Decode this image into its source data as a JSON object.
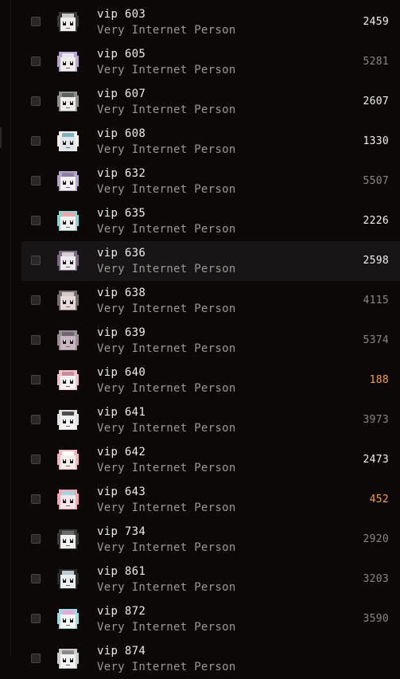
{
  "list": {
    "rows": [
      {
        "name": "vip 603",
        "subtitle": "Very Internet Person",
        "value": "2459",
        "value_style": "bright",
        "avatar": {
          "hair": "#3a3a3a",
          "face": "#f1ecec",
          "accent": "#c8c8c8"
        }
      },
      {
        "name": "vip 605",
        "subtitle": "Very Internet Person",
        "value": "5281",
        "value_style": "dim",
        "avatar": {
          "hair": "#b9a6cf",
          "face": "#f1ecec",
          "accent": "#e9e4f2"
        }
      },
      {
        "name": "vip 607",
        "subtitle": "Very Internet Person",
        "value": "2607",
        "value_style": "bright",
        "avatar": {
          "hair": "#8f918f",
          "face": "#f1ecec",
          "accent": "#5d625f"
        }
      },
      {
        "name": "vip 608",
        "subtitle": "Very Internet Person",
        "value": "1330",
        "value_style": "bright",
        "avatar": {
          "hair": "#f4eee6",
          "face": "#dfe7ea",
          "accent": "#7fb1bd"
        }
      },
      {
        "name": "vip 632",
        "subtitle": "Very Internet Person",
        "value": "5507",
        "value_style": "dim",
        "avatar": {
          "hair": "#b7a6c8",
          "face": "#f3eef3",
          "accent": "#8c7fa2"
        }
      },
      {
        "name": "vip 635",
        "subtitle": "Very Internet Person",
        "value": "2226",
        "value_style": "bright",
        "avatar": {
          "hair": "#8ed3cf",
          "face": "#f3f1f0",
          "accent": "#f0a6a6"
        }
      },
      {
        "name": "vip 636",
        "subtitle": "Very Internet Person",
        "value": "2598",
        "value_style": "bright",
        "avatar": {
          "hair": "#7b6c84",
          "face": "#efe8ee",
          "accent": "#d6d0d8"
        }
      },
      {
        "name": "vip 638",
        "subtitle": "Very Internet Person",
        "value": "4115",
        "value_style": "dim",
        "avatar": {
          "hair": "#7a6f6f",
          "face": "#e7d9d9",
          "accent": "#d2c9c9"
        }
      },
      {
        "name": "vip 639",
        "subtitle": "Very Internet Person",
        "value": "5374",
        "value_style": "dim",
        "avatar": {
          "hair": "#9b8e94",
          "face": "#c9b7c4",
          "accent": "#6f6570"
        }
      },
      {
        "name": "vip 640",
        "subtitle": "Very Internet Person",
        "value": "188",
        "value_style": "orange",
        "avatar": {
          "hair": "#f1c4cb",
          "face": "#f6f2f4",
          "accent": "#c98aa0"
        }
      },
      {
        "name": "vip 641",
        "subtitle": "Very Internet Person",
        "value": "3973",
        "value_style": "dim",
        "avatar": {
          "hair": "#e3e3e3",
          "face": "#f4f4f4",
          "accent": "#4e4e4e"
        }
      },
      {
        "name": "vip 642",
        "subtitle": "Very Internet Person",
        "value": "2473",
        "value_style": "bright",
        "avatar": {
          "hair": "#f2b6bf",
          "face": "#f3ece8",
          "accent": "#ffffff"
        }
      },
      {
        "name": "vip 643",
        "subtitle": "Very Internet Person",
        "value": "452",
        "value_style": "orange",
        "avatar": {
          "hair": "#f1aab3",
          "face": "#f3e6ea",
          "accent": "#a9d2dc"
        }
      },
      {
        "name": "vip 734",
        "subtitle": "Very Internet Person",
        "value": "2920",
        "value_style": "dim",
        "avatar": {
          "hair": "#3c3c3c",
          "face": "#f1f1f1",
          "accent": "#6a6a6a"
        }
      },
      {
        "name": "vip 861",
        "subtitle": "Very Internet Person",
        "value": "3203",
        "value_style": "dim",
        "avatar": {
          "hair": "#2c2c2c",
          "face": "#e9eef0",
          "accent": "#bfc9cd"
        }
      },
      {
        "name": "vip 872",
        "subtitle": "Very Internet Person",
        "value": "3590",
        "value_style": "dim",
        "avatar": {
          "hair": "#9fdbe0",
          "face": "#f2f3f3",
          "accent": "#e0a9d6"
        }
      },
      {
        "name": "vip 874",
        "subtitle": "Very Internet Person",
        "value": "",
        "value_style": "dim",
        "avatar": {
          "hair": "#cfcfcf",
          "face": "#f1f1f1",
          "accent": "#8a8a8a"
        }
      }
    ],
    "hover_row": 6
  }
}
